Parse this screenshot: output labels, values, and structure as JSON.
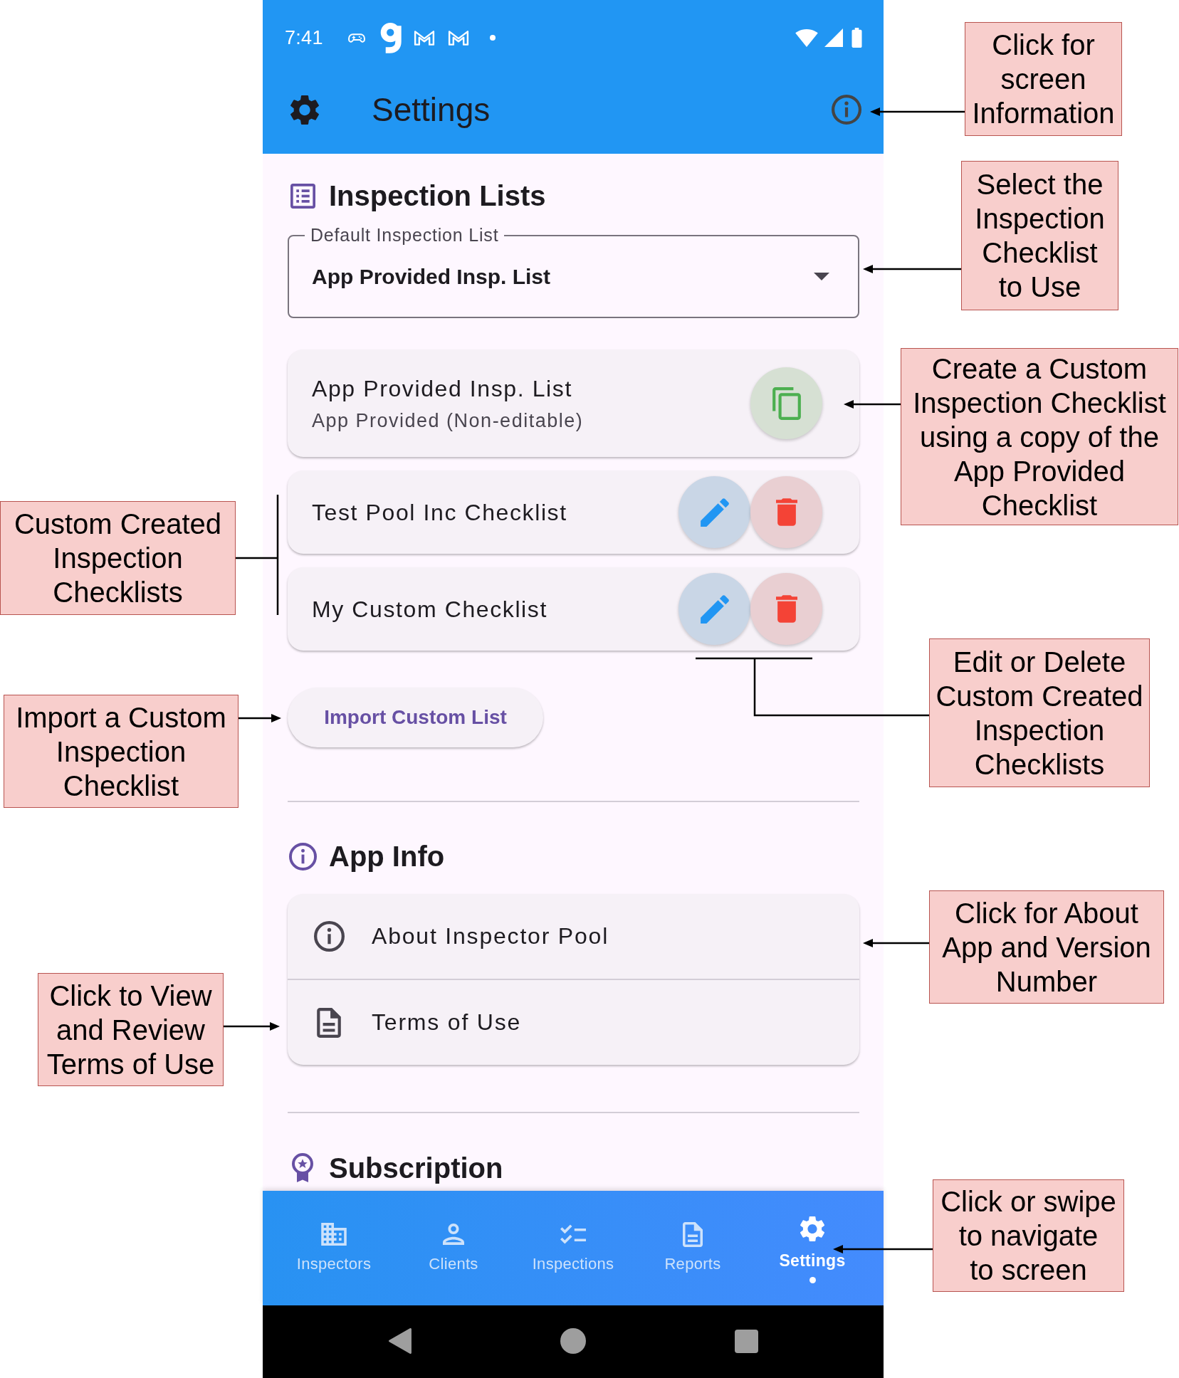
{
  "status_bar": {
    "time": "7:41"
  },
  "app_bar": {
    "title": "Settings"
  },
  "inspection_lists": {
    "title": "Inspection Lists",
    "dropdown": {
      "label": "Default Inspection List",
      "value": "App Provided Insp. List"
    },
    "checklists": [
      {
        "kind": "provided",
        "name": "App Provided Insp. List",
        "subtitle": "App Provided (Non-editable)"
      },
      {
        "kind": "custom",
        "name": "Test Pool Inc Checklist"
      },
      {
        "kind": "custom",
        "name": "My Custom Checklist"
      }
    ],
    "import_button": "Import Custom List"
  },
  "app_info": {
    "title": "App Info",
    "items": [
      "About Inspector Pool",
      "Terms of Use"
    ]
  },
  "subscription": {
    "title": "Subscription"
  },
  "bottom_nav": [
    {
      "label": "Inspectors",
      "selected": false
    },
    {
      "label": "Clients",
      "selected": false
    },
    {
      "label": "Inspections",
      "selected": false
    },
    {
      "label": "Reports",
      "selected": false
    },
    {
      "label": "Settings",
      "selected": true
    }
  ],
  "annotations": [
    {
      "lines": [
        "Click for",
        "screen",
        "Information"
      ]
    },
    {
      "lines": [
        "Select the",
        "Inspection",
        "Checklist",
        "to Use"
      ]
    },
    {
      "lines": [
        "Create a Custom",
        "Inspection Checklist",
        "using a copy of the",
        "App Provided",
        "Checklist"
      ]
    },
    {
      "lines": [
        "Custom Created",
        "Inspection",
        "Checklists"
      ]
    },
    {
      "lines": [
        "Edit or Delete",
        "Custom Created",
        "Inspection",
        "Checklists"
      ]
    },
    {
      "lines": [
        "Import a Custom",
        "Inspection",
        "Checklist"
      ]
    },
    {
      "lines": [
        "Click for About",
        "App and Version",
        "Number"
      ]
    },
    {
      "lines": [
        "Click to View",
        "and Review",
        "Terms of Use"
      ]
    },
    {
      "lines": [
        "Click or swipe",
        "to navigate",
        "to screen"
      ]
    }
  ]
}
